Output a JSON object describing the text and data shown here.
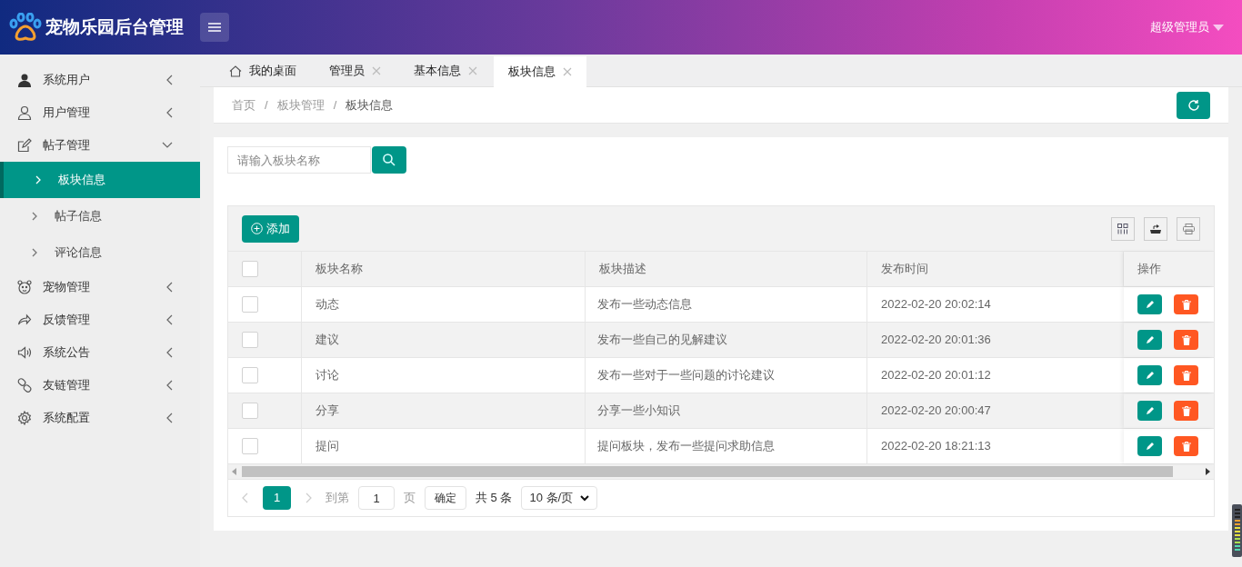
{
  "header": {
    "title": "宠物乐园后台管理",
    "user": "超级管理员"
  },
  "sidebar": {
    "items": [
      {
        "label": "系统用户",
        "expanded": false
      },
      {
        "label": "用户管理",
        "expanded": false
      },
      {
        "label": "帖子管理",
        "expanded": true,
        "children": [
          {
            "label": "板块信息",
            "selected": true
          },
          {
            "label": "帖子信息",
            "selected": false
          },
          {
            "label": "评论信息",
            "selected": false
          }
        ]
      },
      {
        "label": "宠物管理",
        "expanded": false
      },
      {
        "label": "反馈管理",
        "expanded": false
      },
      {
        "label": "系统公告",
        "expanded": false
      },
      {
        "label": "友链管理",
        "expanded": false
      },
      {
        "label": "系统配置",
        "expanded": false
      }
    ]
  },
  "tabs": [
    {
      "label": "我的桌面",
      "selected": false,
      "closable": false
    },
    {
      "label": "管理员",
      "selected": false,
      "closable": true
    },
    {
      "label": "基本信息",
      "selected": false,
      "closable": true
    },
    {
      "label": "板块信息",
      "selected": true,
      "closable": true
    }
  ],
  "breadcrumb": {
    "items": [
      "首页",
      "板块管理",
      "板块信息"
    ],
    "separator": "/"
  },
  "search": {
    "placeholder": "请输入板块名称"
  },
  "toolbar": {
    "add_label": "添加"
  },
  "table": {
    "select_all_checked": false,
    "columns": [
      "板块名称",
      "板块描述",
      "发布时间",
      "操作"
    ],
    "rows": [
      {
        "name": "动态",
        "description": "发布一些动态信息",
        "time": "2022-02-20 20:02:14",
        "checked": false
      },
      {
        "name": "建议",
        "description": "发布一些自己的见解建议",
        "time": "2022-02-20 20:01:36",
        "checked": false
      },
      {
        "name": "讨论",
        "description": "发布一些对于一些问题的讨论建议",
        "time": "2022-02-20 20:01:12",
        "checked": false
      },
      {
        "name": "分享",
        "description": "分享一些小知识",
        "time": "2022-02-20 20:00:47",
        "checked": false
      },
      {
        "name": "提问",
        "description": "提问板块，发布一些提问求助信息",
        "time": "2022-02-20 18:21:13",
        "checked": false
      }
    ]
  },
  "pagination": {
    "current": "1",
    "goto_label": "到第",
    "goto_value": "1",
    "page_label": "页",
    "confirm": "确定",
    "total": "共 5 条",
    "page_size": "10 条/页"
  }
}
